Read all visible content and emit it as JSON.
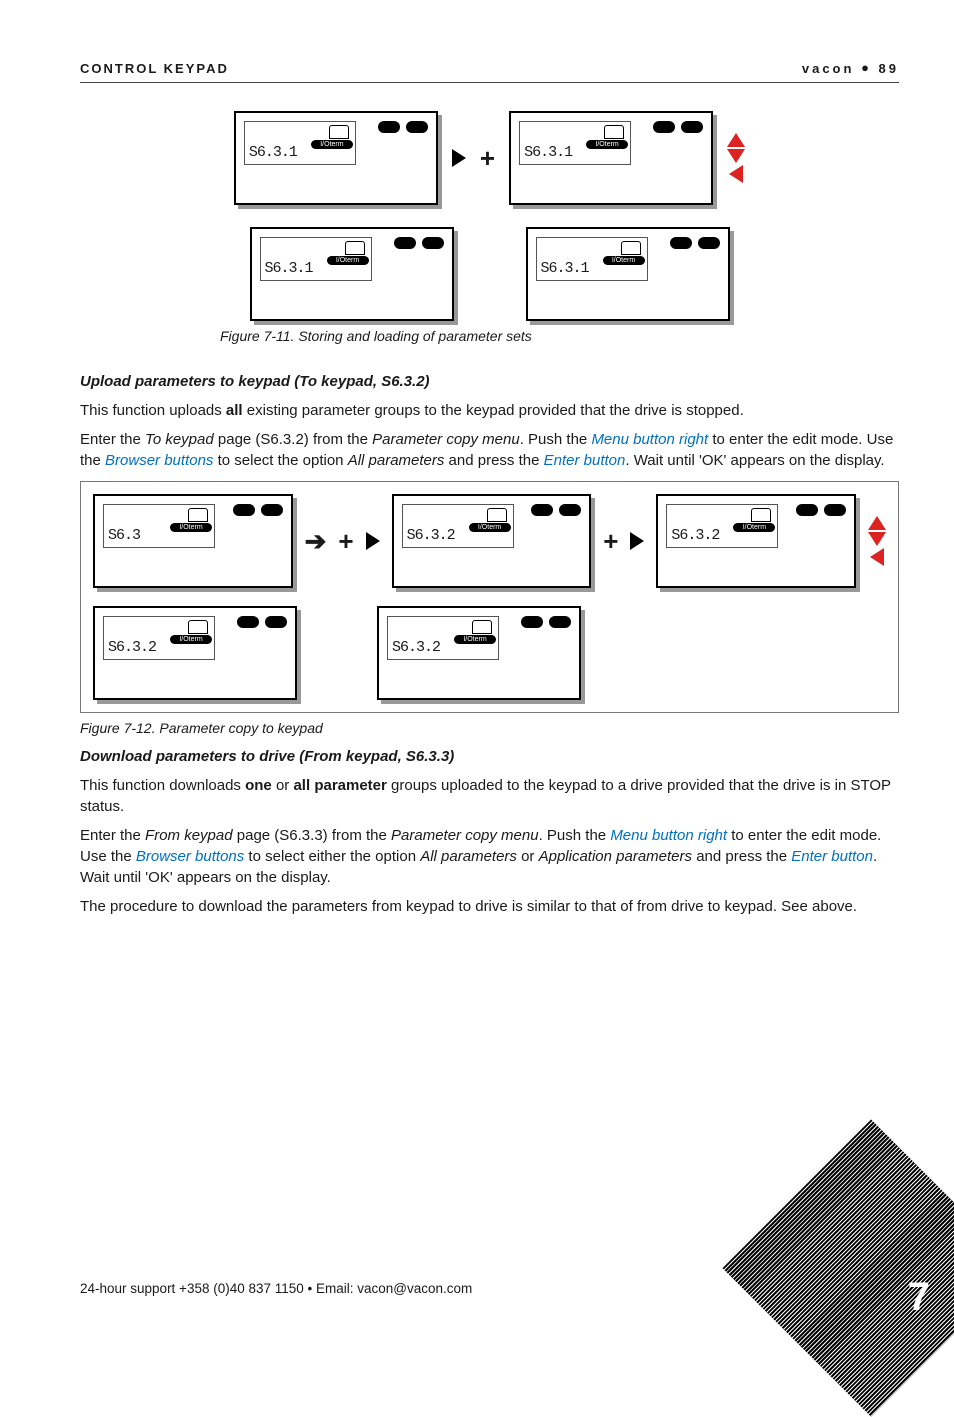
{
  "header": {
    "left": "CONTROL KEYPAD",
    "right_brand": "vacon",
    "right_page": "89"
  },
  "fig1": {
    "panels": {
      "tl": {
        "code": "S6.3.1",
        "label": "I/Oterm"
      },
      "tr": {
        "code": "S6.3.1",
        "label": "I/Oterm"
      },
      "bl": {
        "code": "S6.3.1",
        "label": "I/Oterm"
      },
      "br": {
        "code": "S6.3.1",
        "label": "I/Oterm"
      }
    },
    "caption": "Figure 7-11. Storing and loading of parameter sets"
  },
  "sect1": {
    "title": "Upload parameters to keypad (To keypad, S6.3.2)",
    "p1_a": "This function uploads ",
    "p1_b": "all",
    "p1_c": " existing parameter groups to the keypad provided that the drive is stopped.",
    "p2_a": "Enter the ",
    "p2_b": "To keypad",
    "p2_c": " page (S6.3.2) from the ",
    "p2_d": "Parameter copy menu",
    "p2_e": ". Push the ",
    "p2_f": "Menu button right",
    "p2_g": " to enter the edit mode. Use the ",
    "p2_h": "Browser buttons",
    "p2_i": " to select the option ",
    "p2_j": "All parameters",
    "p2_k": " and press the ",
    "p2_l": "Enter button",
    "p2_m": ". Wait until 'OK' appears on the display."
  },
  "fig2": {
    "panels": {
      "a": {
        "code": "S6.3",
        "label": "I/Oterm"
      },
      "b": {
        "code": "S6.3.2",
        "label": "I/Oterm"
      },
      "c": {
        "code": "S6.3.2",
        "label": "I/Oterm"
      },
      "d": {
        "code": "S6.3.2",
        "label": "I/Oterm"
      },
      "e": {
        "code": "S6.3.2",
        "label": "I/Oterm"
      }
    },
    "caption": "Figure 7-12. Parameter copy to keypad"
  },
  "sect2": {
    "title": "Download parameters to drive (From keypad, S6.3.3)",
    "p1_a": "This function downloads ",
    "p1_b": "one",
    "p1_c": " or ",
    "p1_d": "all parameter",
    "p1_e": " groups uploaded to the keypad to a drive provided that the drive is in STOP status.",
    "p2_a": "Enter the ",
    "p2_b": "From keypad",
    "p2_c": " page (S6.3.3) from the ",
    "p2_d": "Parameter copy menu",
    "p2_e": ". Push the ",
    "p2_f": "Menu button right",
    "p2_g": " to enter the edit mode. Use the ",
    "p2_h": "Browser buttons",
    "p2_i": " to select either the option ",
    "p2_j": "All parameters",
    "p2_k": " or ",
    "p2_l": "Application parameters",
    "p2_m": " and press the ",
    "p2_n": "Enter button",
    "p2_o": ". Wait until 'OK' appears on the display.",
    "p3": "The procedure to download the parameters from keypad to drive is similar to that of from drive to keypad. See above."
  },
  "footer": "24-hour support +358 (0)40 837 1150 • Email: vacon@vacon.com",
  "page_number": "7"
}
